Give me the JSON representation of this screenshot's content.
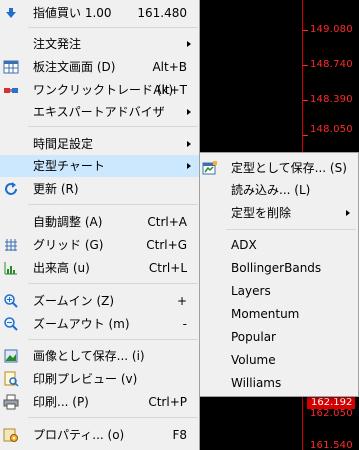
{
  "colors": {
    "menu_bg": "#f0f0f0",
    "highlight": "#cce8ff",
    "chart_bg": "#000000",
    "price_axis": "#ff2a2a",
    "price_tag_bg": "#d50000"
  },
  "chart": {
    "price_ticks": [
      "149.080",
      "148.740",
      "148.390",
      "148.050",
      "162.192",
      "162.050",
      "161.540"
    ],
    "current_price": "162.192"
  },
  "menu": {
    "items": [
      {
        "label": "指値買い 1.00",
        "shortcut": "161.480",
        "icon": "down-arrow-icon"
      },
      {
        "label": "注文発注",
        "icon": ""
      },
      {
        "label": "板注文画面 (D)",
        "shortcut": "Alt+B",
        "icon": "dom-grid-icon"
      },
      {
        "label": "ワンクリックトレード (k)",
        "shortcut": "Alt+T",
        "icon": "one-click-trade-icon"
      },
      {
        "label": "エキスパートアドバイザ",
        "icon": ""
      },
      {
        "label": "時間足設定",
        "icon": ""
      },
      {
        "label": "定型チャート",
        "icon": ""
      },
      {
        "label": "更新 (R)",
        "icon": "refresh-icon"
      },
      {
        "label": "自動調整 (A)",
        "shortcut": "Ctrl+A",
        "icon": ""
      },
      {
        "label": "グリッド (G)",
        "shortcut": "Ctrl+G",
        "icon": "grid-icon"
      },
      {
        "label": "出来高 (u)",
        "shortcut": "Ctrl+L",
        "icon": "volume-icon"
      },
      {
        "label": "ズームイン (Z)",
        "shortcut": "+",
        "icon": "zoom-in-icon"
      },
      {
        "label": "ズームアウト (m)",
        "shortcut": "-",
        "icon": "zoom-out-icon"
      },
      {
        "label": "画像として保存... (i)",
        "icon": "save-image-icon"
      },
      {
        "label": "印刷プレビュー (v)",
        "icon": "print-preview-icon"
      },
      {
        "label": "印刷... (P)",
        "shortcut": "Ctrl+P",
        "icon": "printer-icon"
      },
      {
        "label": "プロパティ... (o)",
        "shortcut": "F8",
        "icon": "properties-icon"
      }
    ]
  },
  "submenu": {
    "items": [
      {
        "label": "定型として保存... (S)",
        "icon": "save-template-icon"
      },
      {
        "label": "読み込み... (L)"
      },
      {
        "label": "定型を削除"
      },
      {
        "label": "ADX"
      },
      {
        "label": "BollingerBands"
      },
      {
        "label": "Layers"
      },
      {
        "label": "Momentum"
      },
      {
        "label": "Popular"
      },
      {
        "label": "Volume"
      },
      {
        "label": "Williams"
      }
    ]
  }
}
